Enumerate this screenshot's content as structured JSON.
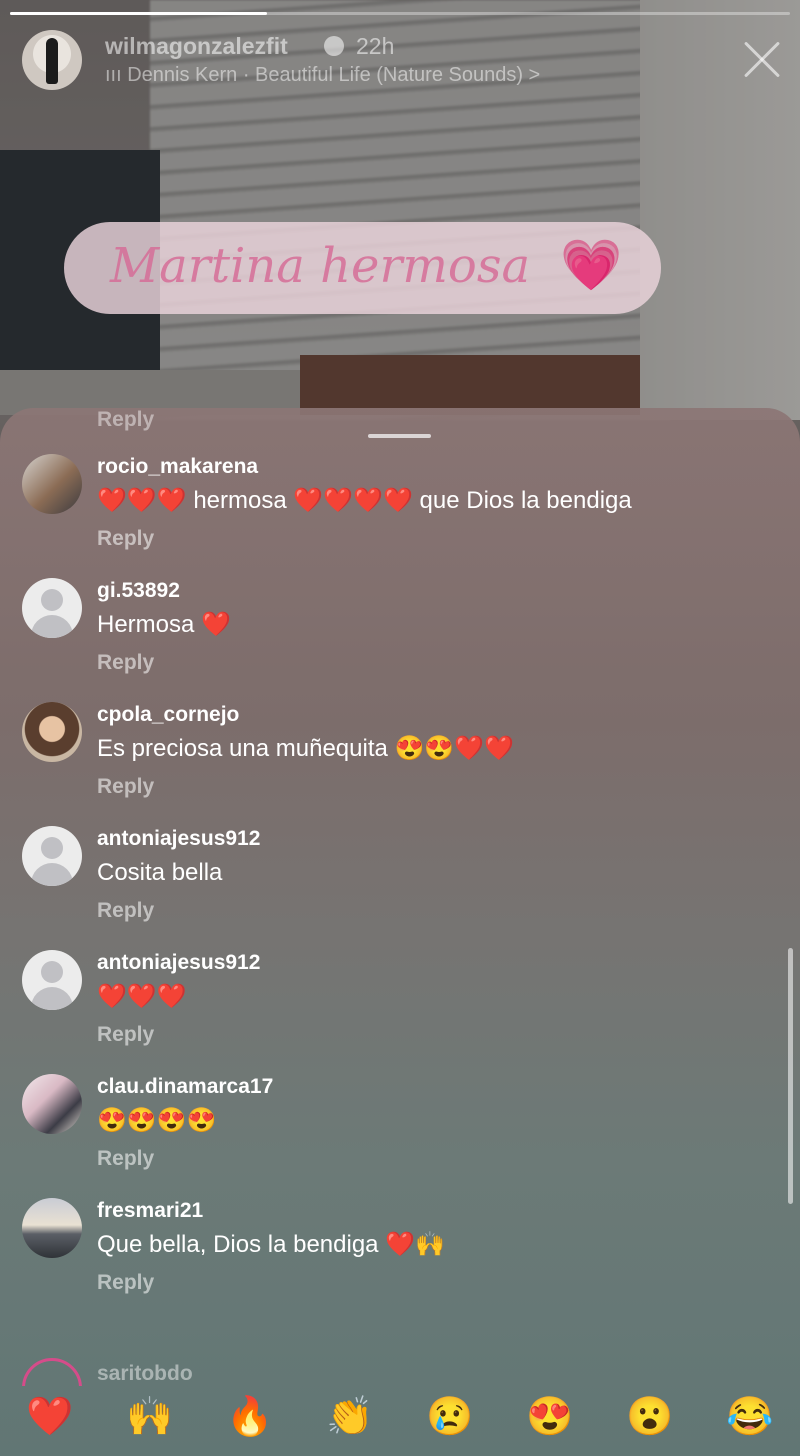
{
  "story": {
    "progress": 0.33,
    "username": "wilmagonzalezfit",
    "time": "22h",
    "music": "ııı Dennis Kern · Beautiful Life (Nature Sounds) >",
    "sticker_text": "Martina hermosa",
    "sticker_emoji": "💗"
  },
  "sheet": {
    "cut_reply_label": "Reply",
    "comments": [
      {
        "user": "rocio_makarena",
        "text": "❤️❤️❤️ hermosa ❤️❤️❤️❤️ que Dios la bendiga",
        "reply": "Reply",
        "avatar": "photo1"
      },
      {
        "user": "gi.53892",
        "text": "Hermosa ❤️",
        "reply": "Reply",
        "avatar": "default"
      },
      {
        "user": "cpola_cornejo",
        "text": "Es preciosa una muñequita 😍😍❤️❤️",
        "reply": "Reply",
        "avatar": "photo2"
      },
      {
        "user": "antoniajesus912",
        "text": "Cosita bella",
        "reply": "Reply",
        "avatar": "default"
      },
      {
        "user": "antoniajesus912",
        "text": "❤️❤️❤️",
        "reply": "Reply",
        "avatar": "default"
      },
      {
        "user": "clau.dinamarca17",
        "text": "😍😍😍😍",
        "reply": "Reply",
        "avatar": "photo3"
      },
      {
        "user": "fresmari21",
        "text": "Que bella, Dios la bendiga ❤️🙌",
        "reply": "Reply",
        "avatar": "photo4"
      }
    ],
    "peek_user": "saritobdo"
  },
  "reactions": [
    "❤️",
    "🙌",
    "🔥",
    "👏",
    "😢",
    "😍",
    "😮",
    "😂"
  ]
}
